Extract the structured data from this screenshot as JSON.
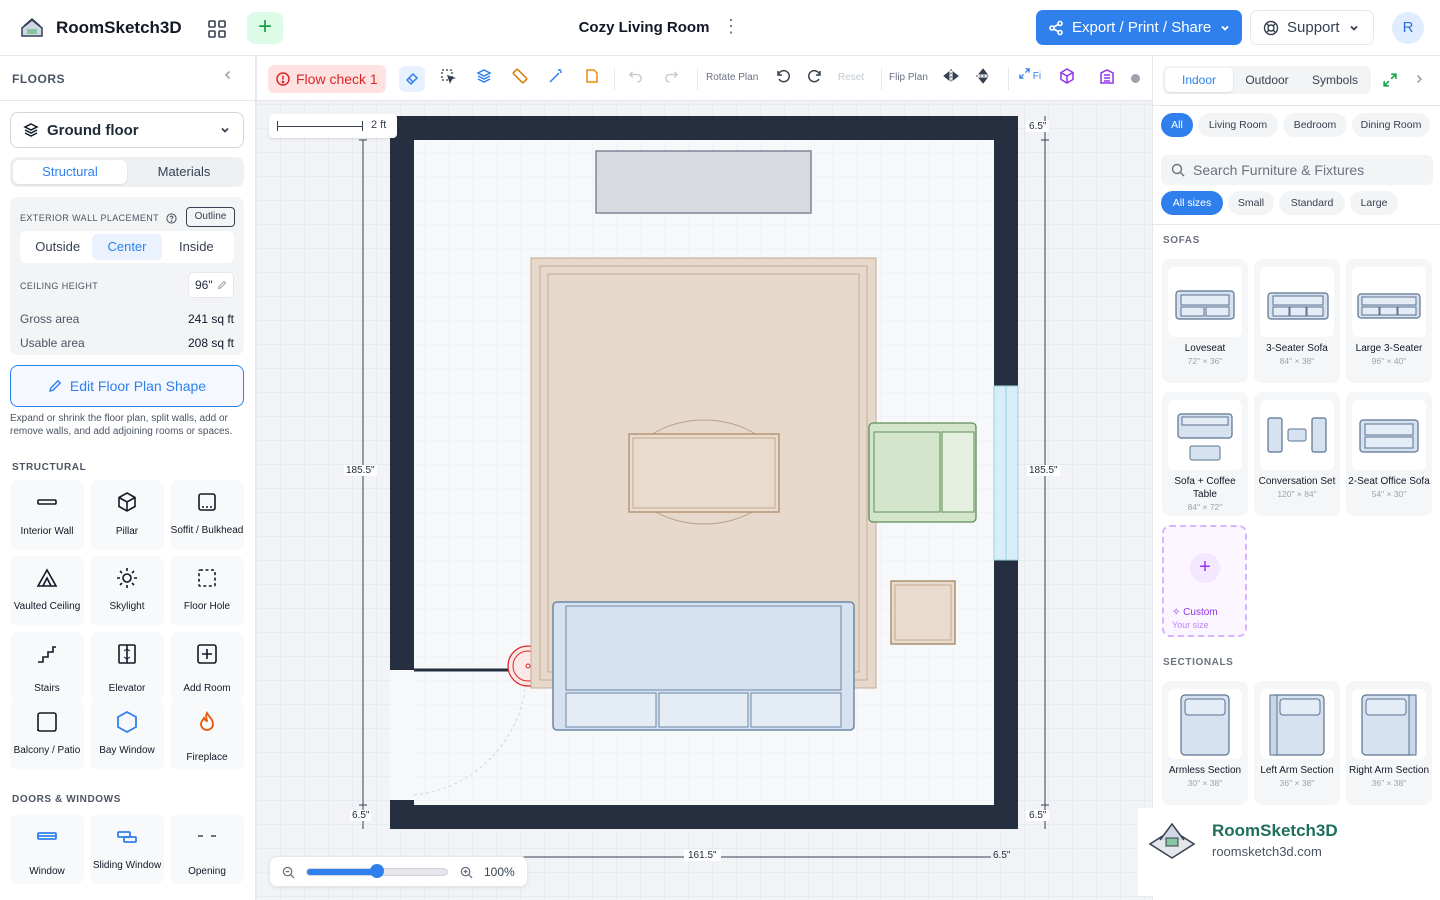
{
  "app": {
    "name": "RoomSketch3D",
    "doc_title": "Cozy Living Room",
    "export_label": "Export / Print / Share",
    "support_label": "Support",
    "avatar_initial": "R"
  },
  "left": {
    "floors_heading": "FLOORS",
    "floor_selected": "Ground floor",
    "tabs": [
      "Structural",
      "Materials"
    ],
    "ewp_label": "EXTERIOR WALL PLACEMENT",
    "outline_label": "Outline",
    "placement": [
      "Outside",
      "Center",
      "Inside"
    ],
    "ceiling_label": "CEILING HEIGHT",
    "ceiling_value": "96\"",
    "gross_label": "Gross area",
    "gross_value": "241 sq ft",
    "usable_label": "Usable area",
    "usable_value": "208 sq ft",
    "edit_button": "Edit Floor Plan Shape",
    "help_text": "Expand or shrink the floor plan, split walls, add or remove walls, and add adjoining rooms or spaces.",
    "structural_heading": "STRUCTURAL",
    "structural_items": [
      {
        "label": "Interior Wall",
        "icon": "interior-wall-icon"
      },
      {
        "label": "Pillar",
        "icon": "pillar-icon"
      },
      {
        "label": "Soffit / Bulkhead",
        "icon": "soffit-icon"
      },
      {
        "label": "Vaulted Ceiling",
        "icon": "vaulted-ceiling-icon"
      },
      {
        "label": "Skylight",
        "icon": "skylight-icon"
      },
      {
        "label": "Floor Hole",
        "icon": "floor-hole-icon"
      },
      {
        "label": "Stairs",
        "icon": "stairs-icon"
      },
      {
        "label": "Elevator",
        "icon": "elevator-icon"
      },
      {
        "label": "Add Room",
        "icon": "add-room-icon"
      },
      {
        "label": "Balcony / Patio",
        "icon": "balcony-icon"
      },
      {
        "label": "Bay Window",
        "icon": "bay-window-icon"
      },
      {
        "label": "Fireplace",
        "icon": "fireplace-icon"
      }
    ],
    "doors_heading": "DOORS & WINDOWS",
    "doors_items": [
      {
        "label": "Window",
        "icon": "window-icon"
      },
      {
        "label": "Sliding Window",
        "icon": "sliding-window-icon"
      },
      {
        "label": "Opening",
        "icon": "opening-icon"
      }
    ]
  },
  "toolbar": {
    "flow_check": "Flow check 1",
    "rotate_label": "Rotate Plan",
    "reset_label": "Reset",
    "flip_label": "Flip Plan",
    "fit_label": "Fi"
  },
  "canvas": {
    "scale_label": "2 ft",
    "dims": {
      "top_right": "6.5\"",
      "left_height": "185.5\"",
      "right_height": "185.5\"",
      "bottom_left": "6.5\"",
      "bottom_right": "6.5\"",
      "bottom_width": "161.5\"",
      "bottom_right2": "6.5\""
    },
    "zoom": "100%",
    "zoom_level": 0.5
  },
  "right": {
    "tabs": [
      "Indoor",
      "Outdoor",
      "Symbols"
    ],
    "rooms": [
      "All",
      "Living Room",
      "Bedroom",
      "Dining Room"
    ],
    "search_placeholder": "Search Furniture & Fixtures",
    "sizes": [
      "All sizes",
      "Small",
      "Standard",
      "Large"
    ],
    "sofas_heading": "SOFAS",
    "sofas": [
      {
        "name": "Loveseat",
        "dims": "72\" × 36\""
      },
      {
        "name": "3-Seater Sofa",
        "dims": "84\" × 38\""
      },
      {
        "name": "Large 3-Seater",
        "dims": "96\" × 40\""
      },
      {
        "name": "Sofa + Coffee Table",
        "dims": "84\" × 72\""
      },
      {
        "name": "Conversation Set",
        "dims": "120\" × 84\""
      },
      {
        "name": "2-Seat Office Sofa",
        "dims": "54\" × 30\""
      }
    ],
    "custom_label": "Custom",
    "custom_sub": "Your size",
    "sectionals_heading": "SECTIONALS",
    "sectionals": [
      {
        "name": "Armless Section",
        "dims": "30\" × 38\""
      },
      {
        "name": "Left Arm Section",
        "dims": "36\" × 38\""
      },
      {
        "name": "Right Arm Section",
        "dims": "36\" × 38\""
      }
    ]
  },
  "watermark": {
    "name": "RoomSketch3D",
    "url": "roomsketch3d.com"
  },
  "colors": {
    "accent": "#2f80ed",
    "wall": "#262f40",
    "rug": "#e6d9cb",
    "sofa": "#d6e2f0",
    "chair": "#d3e6cc",
    "danger": "#dc2626"
  }
}
